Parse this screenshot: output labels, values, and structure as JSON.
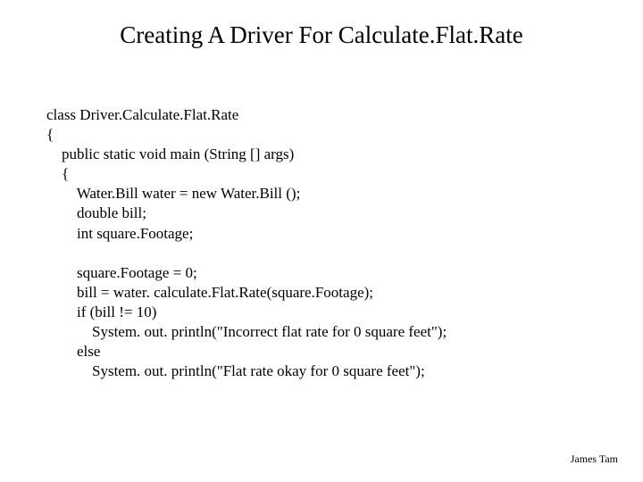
{
  "title": "Creating A Driver For Calculate.Flat.Rate",
  "code": "class Driver.Calculate.Flat.Rate\n{\n    public static void main (String [] args)\n    {\n        Water.Bill water = new Water.Bill ();\n        double bill;\n        int square.Footage;\n\n        square.Footage = 0;\n        bill = water. calculate.Flat.Rate(square.Footage);\n        if (bill != 10)\n            System. out. println(\"Incorrect flat rate for 0 square feet\");\n        else\n            System. out. println(\"Flat rate okay for 0 square feet\");",
  "footer": "James Tam"
}
